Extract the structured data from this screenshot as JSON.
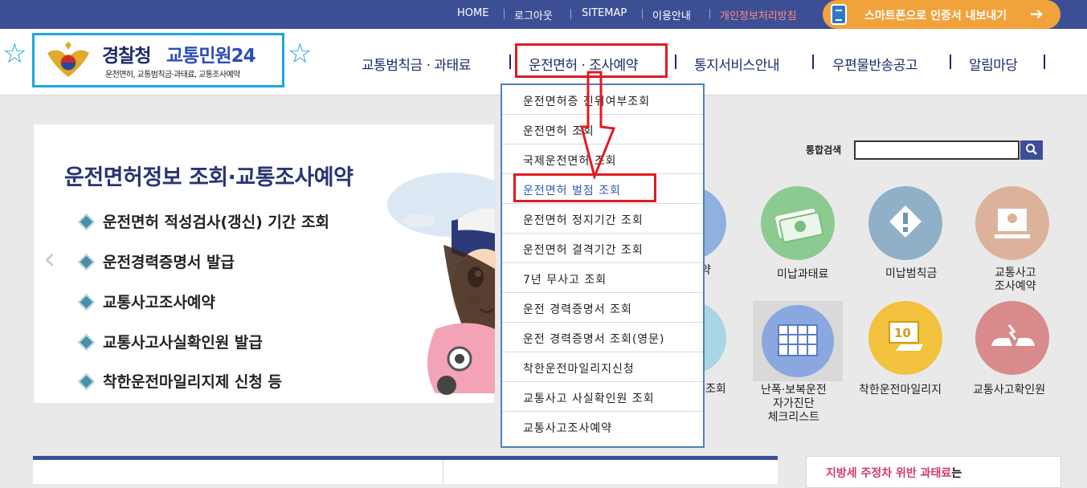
{
  "topbar": {
    "links": [
      "HOME",
      "로그아웃",
      "SITEMAP",
      "이용안내",
      "개인정보처리방침"
    ],
    "smart_button": "스마트폰으로 인증서 내보내기"
  },
  "logo": {
    "title_a": "경찰청",
    "title_b": "교통민원24",
    "subtitle": "운전면허, 교통범칙금·과태료, 교통조사예약"
  },
  "gnb": {
    "items": [
      "교통범칙금 · 과태료",
      "운전면허 · 조사예약",
      "통지서비스안내",
      "우편물반송공고",
      "알림마당"
    ]
  },
  "main_panel": {
    "title": "운전면허정보 조회·교통조사예약",
    "items": [
      "운전면허 적성검사(갱신) 기간 조회",
      "운전경력증명서 발급",
      "교통사고조사예약",
      "교통사고사실확인원 발급",
      "착한운전마일리지제 신청 등"
    ]
  },
  "search": {
    "label": "통합검색",
    "value": ""
  },
  "services": {
    "row1": [
      "약",
      "미납과태료",
      "미납범칙금",
      "교통사고\n조사예약"
    ],
    "row2": [
      "조회",
      "난폭·보복운전\n자가진단\n체크리스트",
      "착한운전마일리지",
      "교통사고확인원"
    ]
  },
  "dropdown": {
    "items": [
      "운전면허증 진위여부조회",
      "운전면허 조회",
      "국제운전면허 조회",
      "운전면허 벌점 조회",
      "운전면허 정지기간 조회",
      "운전면허 결격기간 조회",
      "7년 무사고 조회",
      "운전 경력증명서 조회",
      "운전 경력증명서 조회(영문)",
      "착한운전마일리지신청",
      "교통사고 사실확인원 조회",
      "교통사고조사예약"
    ],
    "highlighted_index": 3
  },
  "notice": {
    "text_a": "지방세 주정차 위반 과태료",
    "text_b": "는"
  },
  "colors": {
    "topbar": "#3c4f95",
    "highlight": "#e01b24",
    "logo_border": "#1aa7e0",
    "smart_button": "#f2a23a"
  },
  "icons": [
    "star-icon",
    "phone-icon",
    "arrow-right-icon",
    "search-icon",
    "chevron-left-icon",
    "money-icon",
    "warning-icon",
    "monitor-icon",
    "calendar-icon",
    "mileage-icon",
    "crash-icon"
  ]
}
